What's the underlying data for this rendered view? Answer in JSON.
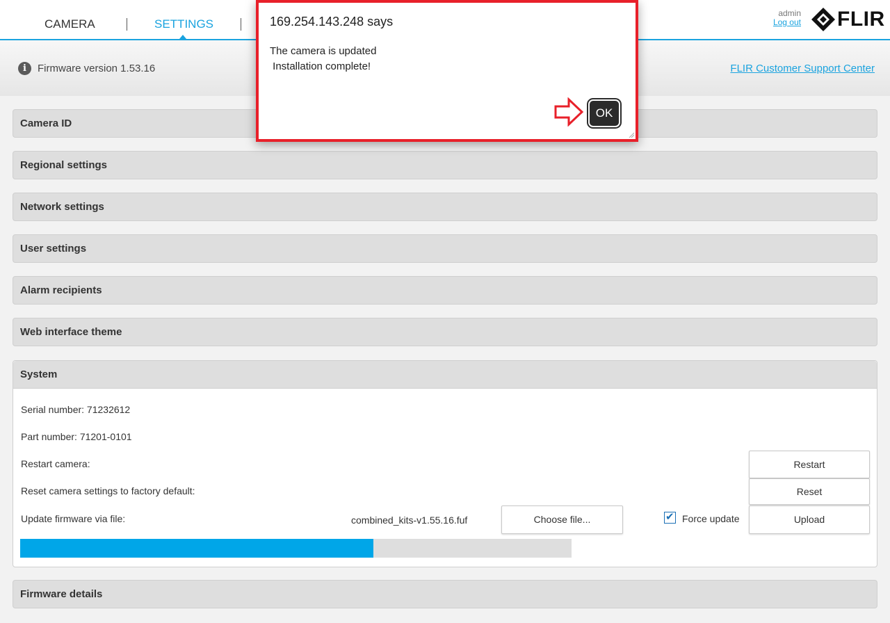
{
  "header": {
    "tabs": [
      {
        "label": "CAMERA"
      },
      {
        "label": "SETTINGS"
      }
    ],
    "user": {
      "name": "admin",
      "logout_label": "Log out"
    },
    "logo_text": "FLIR",
    "accent_color": "#1aa3df"
  },
  "infobar": {
    "firmware_version": "Firmware version 1.53.16",
    "support_link": "FLIR Customer Support Center"
  },
  "panels": [
    {
      "title": "Camera ID"
    },
    {
      "title": "Regional settings"
    },
    {
      "title": "Network settings"
    },
    {
      "title": "User settings"
    },
    {
      "title": "Alarm recipients"
    },
    {
      "title": "Web interface theme"
    },
    {
      "title": "System"
    },
    {
      "title": "Firmware details"
    }
  ],
  "system": {
    "serial_number": "Serial number: 71232612",
    "part_number": "Part number: 71201-0101",
    "restart_label": "Restart camera:",
    "restart_button": "Restart",
    "reset_label": "Reset camera settings to factory default:",
    "reset_button": "Reset",
    "update_label": "Update firmware via file:",
    "selected_file": "combined_kits-v1.55.16.fuf",
    "choose_file_button": "Choose file...",
    "force_update_label": "Force update",
    "force_update_checked": true,
    "upload_button": "Upload",
    "progress_fraction": 0.64,
    "progress_color": "#00a6e8"
  },
  "dialog": {
    "title": "169.254.143.248 says",
    "message": "The camera is updated\n Installation complete!",
    "ok_label": "OK",
    "highlight_color": "#e8202a"
  }
}
